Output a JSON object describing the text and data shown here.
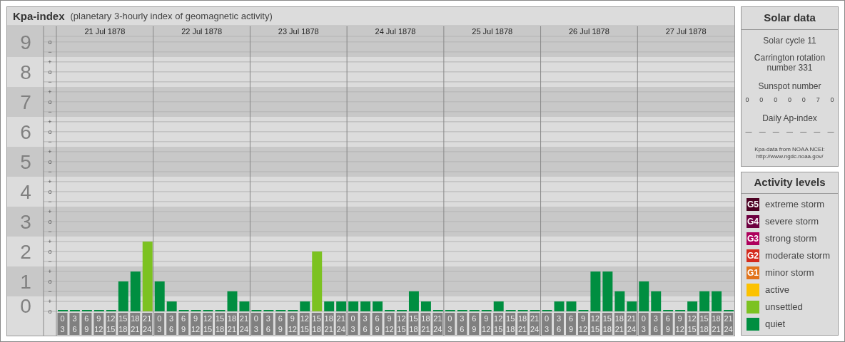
{
  "kpa_panel": {
    "title": "Kpa-index",
    "subtitle": "(planetary 3-hourly index of geomagnetic activity)",
    "days": [
      "21 Jul 1878",
      "22 Jul 1878",
      "23 Jul 1878",
      "24 Jul 1878",
      "25 Jul 1878",
      "26 Jul 1878",
      "27 Jul 1878"
    ],
    "minor_marks": [
      "o",
      "−",
      "+",
      "o",
      "−",
      "+",
      "o",
      "−",
      "+",
      "o",
      "−",
      "+",
      "o",
      "−",
      "+",
      "o",
      "−",
      "+",
      "o",
      "−",
      "+",
      "o",
      "−",
      "+",
      "o",
      "−",
      "+",
      "o"
    ],
    "chart_data": {
      "type": "bar",
      "ylim": [
        0,
        9.52
      ],
      "yticks": [
        0,
        1,
        2,
        3,
        4,
        5,
        6,
        7,
        8,
        9
      ],
      "grid": true,
      "categories": [
        "0 3",
        "3 6",
        "6 9",
        "9 12",
        "12 15",
        "15 18",
        "18 21",
        "21 24",
        "0 3",
        "3 6",
        "6 9",
        "9 12",
        "12 15",
        "15 18",
        "18 21",
        "21 24",
        "0 3",
        "3 6",
        "6 9",
        "9 12",
        "12 15",
        "15 18",
        "18 21",
        "21 24",
        "0 3",
        "3 6",
        "6 9",
        "9 12",
        "12 15",
        "15 18",
        "18 21",
        "21 24",
        "0 3",
        "3 6",
        "6 9",
        "9 12",
        "12 15",
        "15 18",
        "18 21",
        "21 24",
        "0 3",
        "3 6",
        "6 9",
        "9 12",
        "12 15",
        "15 18",
        "18 21",
        "21 24",
        "0 3",
        "3 6",
        "6 9",
        "9 12",
        "12 15",
        "15 18",
        "18 21",
        "21 24"
      ],
      "series": [
        {
          "color": "#008e40",
          "values": [
            0,
            0,
            0,
            0,
            0,
            1,
            1.33,
            null,
            1,
            0.33,
            0,
            0,
            0,
            0,
            0.67,
            0.33,
            0,
            0,
            0,
            0,
            0.33,
            null,
            0.33,
            0.33,
            0.33,
            0.33,
            0.33,
            0,
            0,
            0.67,
            0.33,
            0,
            0,
            0,
            0,
            0,
            0.33,
            0,
            0,
            0,
            0,
            0.33,
            0.33,
            0,
            1.33,
            1.33,
            0.67,
            0.33,
            1,
            0.67,
            0,
            0,
            0.33,
            0.67,
            0.67,
            0
          ]
        },
        {
          "color": "#7cc221",
          "values": [
            null,
            null,
            null,
            null,
            null,
            null,
            null,
            2.33,
            null,
            null,
            null,
            null,
            null,
            null,
            null,
            null,
            null,
            null,
            null,
            null,
            null,
            2,
            null,
            null,
            null,
            null,
            null,
            null,
            null,
            null,
            null,
            null,
            null,
            null,
            null,
            null,
            null,
            null,
            null,
            null,
            null,
            null,
            null,
            null,
            null,
            null,
            null,
            null,
            null,
            null,
            null,
            null,
            null,
            null,
            null,
            null
          ]
        }
      ]
    }
  },
  "solar_data": {
    "title": "Solar data",
    "solar_cycle": "Solar cycle 11",
    "carrington": "Carrington rotation number 331",
    "sunspot_label": "Sunspot number",
    "sunspots": [
      "0",
      "0",
      "0",
      "0",
      "0",
      "7",
      "0"
    ],
    "ap_label": "Daily Ap-index",
    "ap_values": [
      "—",
      "—",
      "—",
      "—",
      "—",
      "—",
      "—"
    ],
    "source": "Kpa-data from NOAA NCEI:",
    "source_link": "http://www.ngdc.noaa.gov/"
  },
  "activity_levels": {
    "title": "Activity levels",
    "items": [
      {
        "badge": "G5",
        "label": "extreme storm",
        "color": "#4c0022"
      },
      {
        "badge": "G4",
        "label": "severe storm",
        "color": "#6e0040"
      },
      {
        "badge": "G3",
        "label": "strong storm",
        "color": "#ae005c"
      },
      {
        "badge": "G2",
        "label": "moderate storm",
        "color": "#d42a1c"
      },
      {
        "badge": "G1",
        "label": "minor storm",
        "color": "#e2731a"
      },
      {
        "label": "active",
        "color": "#fcc200"
      },
      {
        "label": "unsettled",
        "color": "#7cc221"
      },
      {
        "label": "quiet",
        "color": "#008e40"
      }
    ]
  }
}
